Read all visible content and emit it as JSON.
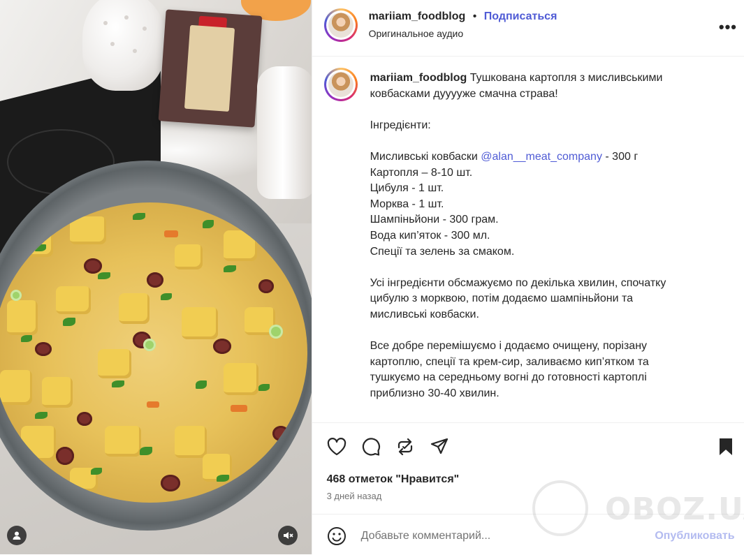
{
  "post": {
    "username": "mariiam_foodblog",
    "separator": "•",
    "follow_label": "Подписаться",
    "audio_label": "Оригинальное аудио",
    "more_label": "•••",
    "caption_username": "mariiam_foodblog",
    "caption_title": "Тушкована картопля з мисливськими ковбасками дууууже смачна страва!",
    "ingredients_heading": "Інгредієнти:",
    "ingredient_sausage_prefix": "Мисливські ковбаски",
    "ingredient_sausage_mention": "@alan__meat_company",
    "ingredient_sausage_suffix": "- 300 г",
    "ingredients": [
      "Картопля – 8-10 шт.",
      "Цибуля - 1 шт.",
      "Морква - 1 шт.",
      "Шампіньйони - 300 грам.",
      "Вода кип’яток - 300 мл.",
      "Спеції та зелень за смаком."
    ],
    "step_1": "Усі інгредієнти обсмажуємо по декілька хвилин, спочатку цибулю з морквою, потім додаємо шампіньйони та мисливські ковбаски.",
    "step_2": "Все добре перемішуємо і додаємо очищену, порізану картоплю, спеції та крем-сир, заливаємо кип’ятком та тушкуємо на середньому вогні до готовності картоплі приблизно 30-40 хвилин.",
    "likes_text": "468 отметок \"Нравится\"",
    "date_text": "3 дней назад",
    "comment_placeholder": "Добавьте комментарий...",
    "publish_label": "Опубликовать"
  },
  "icons": {
    "like": "heart-icon",
    "comment": "comment-icon",
    "repost": "repost-icon",
    "share": "send-icon",
    "save": "bookmark-icon",
    "emoji": "emoji-icon",
    "user": "user-icon",
    "mute": "muted-speaker-icon"
  },
  "watermark": {
    "text": "OBOZ.UA"
  },
  "colors": {
    "link": "#4f5bd5",
    "text": "#262626",
    "muted": "#737373",
    "publish_disabled": "#b3bbf0"
  }
}
